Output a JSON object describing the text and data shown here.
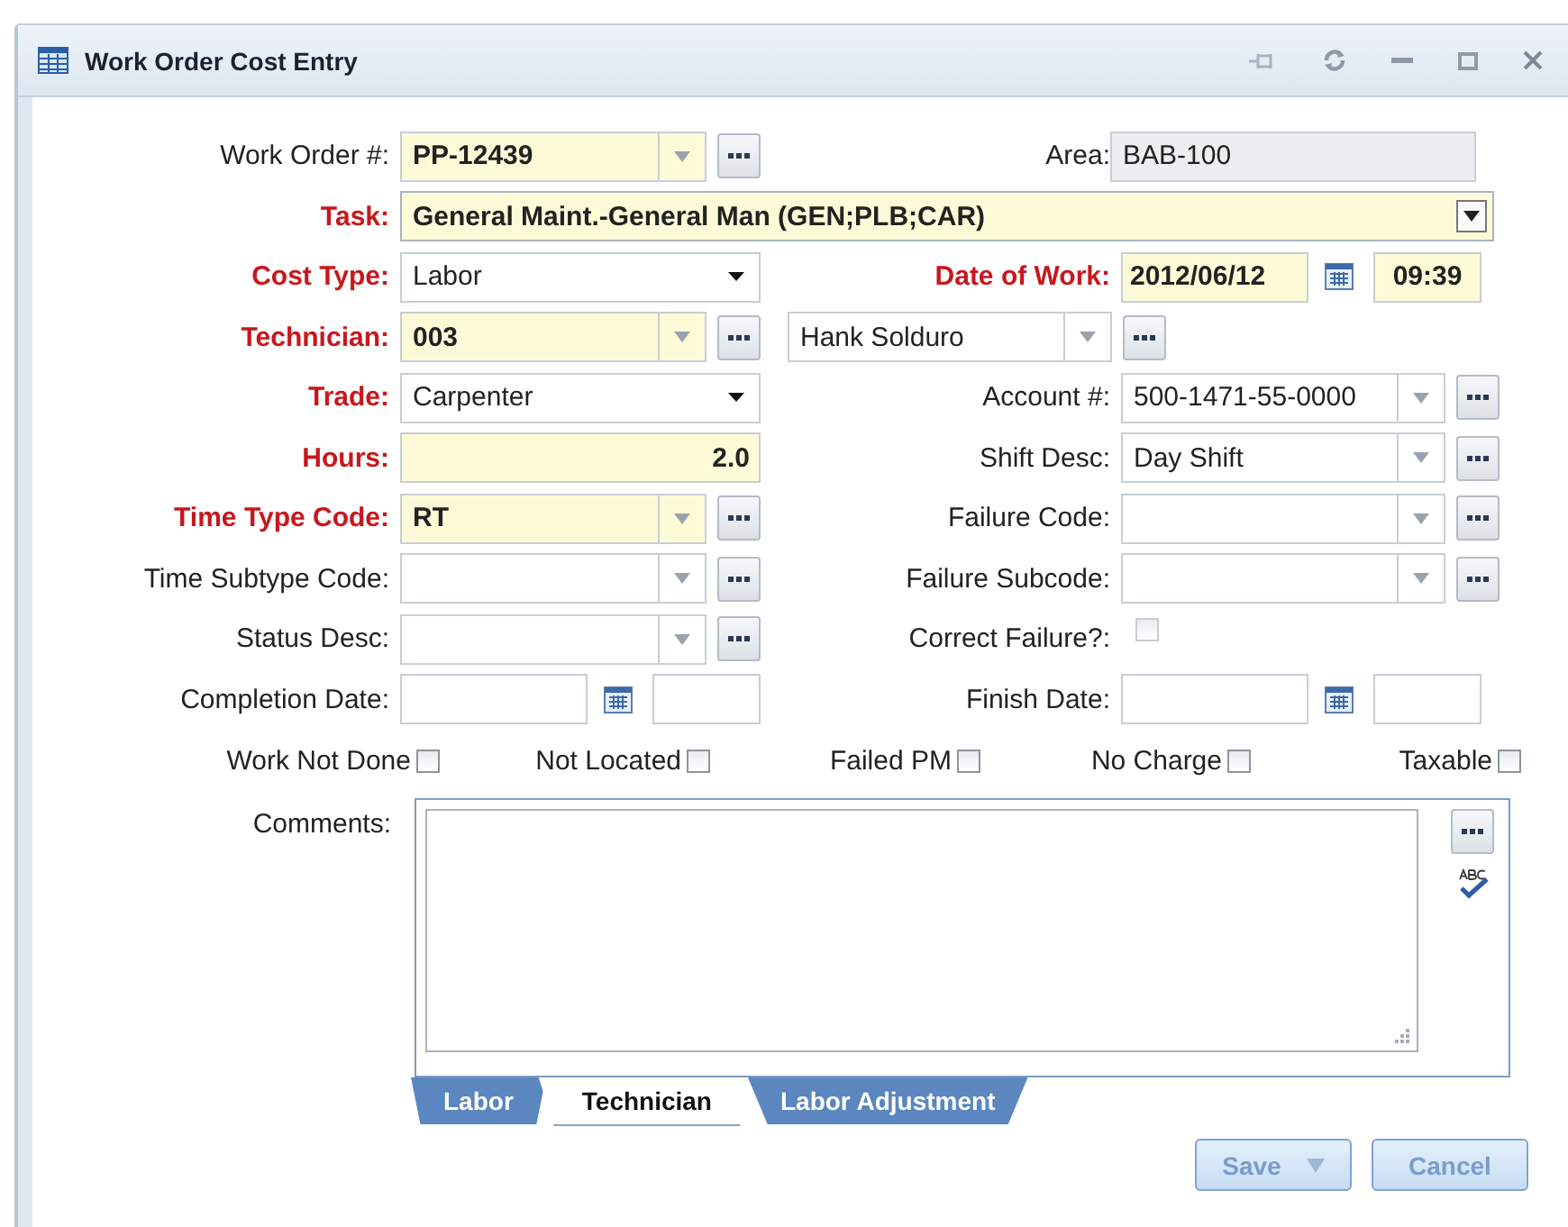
{
  "window": {
    "title": "Work Order Cost Entry"
  },
  "rows": [
    {
      "left": {
        "label": "Work Order #:",
        "required": false,
        "kind": "combo",
        "value": "PP-12439",
        "highlighted": true,
        "lookup": true
      },
      "right": {
        "label": "Area:",
        "required": false,
        "kind": "readonly",
        "value": "BAB-100"
      }
    },
    {
      "left": {
        "label": "Task:",
        "required": true,
        "kind": "wide",
        "value": "General Maint.-General Man (GEN;PLB;CAR)",
        "highlighted": true
      }
    },
    {
      "left": {
        "label": "Cost Type:",
        "required": true,
        "kind": "select",
        "value": "Labor",
        "highlighted": false
      },
      "right": {
        "label": "Date of Work:",
        "required": true,
        "kind": "date",
        "value": "2012/06/12",
        "time": "09:39",
        "highlighted": true
      }
    },
    {
      "left": {
        "label": "Technician:",
        "required": true,
        "kind": "combo",
        "value": "003",
        "highlighted": true,
        "lookup": true
      },
      "right": {
        "kind": "name",
        "value": "Hank Solduro",
        "highlighted": false,
        "lookup": true
      }
    },
    {
      "left": {
        "label": "Trade:",
        "required": true,
        "kind": "select",
        "value": "Carpenter",
        "highlighted": false
      },
      "right": {
        "label": "Account #:",
        "required": false,
        "kind": "combo",
        "value": "500-1471-55-0000",
        "highlighted": false,
        "lookup": true
      }
    },
    {
      "left": {
        "label": "Hours:",
        "required": true,
        "kind": "number",
        "value": "2.0",
        "highlighted": true
      },
      "right": {
        "label": "Shift Desc:",
        "required": false,
        "kind": "combo",
        "value": "Day Shift",
        "highlighted": false,
        "lookup": true
      }
    },
    {
      "left": {
        "label": "Time Type Code:",
        "required": true,
        "kind": "combo",
        "value": "RT",
        "highlighted": true,
        "lookup": true
      },
      "right": {
        "label": "Failure Code:",
        "required": false,
        "kind": "combo",
        "highlighted": false,
        "lookup": true
      }
    },
    {
      "left": {
        "label": "Time Subtype Code:",
        "required": false,
        "kind": "combo",
        "highlighted": false,
        "lookup": true
      },
      "right": {
        "label": "Failure Subcode:",
        "required": false,
        "kind": "combo",
        "highlighted": false,
        "lookup": true
      }
    },
    {
      "left": {
        "label": "Status Desc:",
        "required": false,
        "kind": "combo",
        "highlighted": false,
        "lookup": true
      },
      "right": {
        "label": "Correct Failure?:",
        "required": false,
        "kind": "checkbox",
        "checked": false,
        "disabled": true
      }
    },
    {
      "left": {
        "label": "Completion Date:",
        "required": false,
        "kind": "date",
        "highlighted": false
      },
      "right": {
        "label": "Finish Date:",
        "required": false,
        "kind": "date",
        "highlighted": false
      }
    }
  ],
  "checkboxes": [
    {
      "label": "Work Not Done",
      "checked": false
    },
    {
      "label": "Not Located",
      "checked": false
    },
    {
      "label": "Failed PM",
      "checked": false
    },
    {
      "label": "No Charge",
      "checked": false
    },
    {
      "label": "Taxable",
      "checked": false
    }
  ],
  "comments": {
    "label": "Comments:"
  },
  "tabs": [
    {
      "label": "Labor",
      "selected": false
    },
    {
      "label": "Technician",
      "selected": true
    },
    {
      "label": "Labor Adjustment",
      "selected": false
    }
  ],
  "buttons": [
    {
      "label": "Save",
      "kind": "split"
    },
    {
      "label": "Cancel",
      "kind": "plain"
    }
  ]
}
